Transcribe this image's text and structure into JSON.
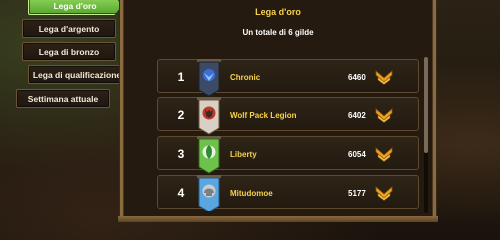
{
  "tabs": [
    {
      "label": "Lega d'oro",
      "active": true
    },
    {
      "label": "Lega d'argento",
      "active": false
    },
    {
      "label": "Lega di bronzo",
      "active": false
    },
    {
      "label": "Lega di qualificazione",
      "active": false
    },
    {
      "label": "Settimana attuale",
      "active": false
    }
  ],
  "panel": {
    "title": "Lega d'oro",
    "subtitle": "Un totale di 6 gilde"
  },
  "guilds": [
    {
      "rank": "1",
      "name": "Chronic",
      "score": "6460",
      "banner_color": "#3c4a66",
      "emblem_color": "#3b6fd8",
      "emblem": "bird-emblem-icon"
    },
    {
      "rank": "2",
      "name": "Wolf Pack Legion",
      "score": "6402",
      "banner_color": "#d8d0c4",
      "emblem_color": "#c0382b",
      "emblem": "wolf-emblem-icon"
    },
    {
      "rank": "3",
      "name": "Liberty",
      "score": "6054",
      "banner_color": "#6cc24a",
      "emblem_color": "#2e8b3a",
      "emblem": "leaf-emblem-icon"
    },
    {
      "rank": "4",
      "name": "Mitudomoe",
      "score": "5177",
      "banner_color": "#5aa6e0",
      "emblem_color": "#7a7f86",
      "emblem": "helmet-emblem-icon"
    }
  ],
  "colors": {
    "accent_gold": "#f7d24a",
    "active_tab": "#6cbf3c",
    "frame": "#8a6a3f"
  }
}
